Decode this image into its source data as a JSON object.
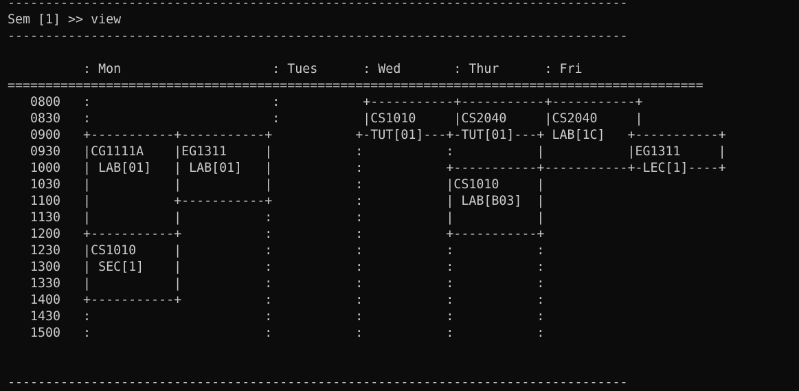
{
  "terminal": {
    "colors": {
      "background": "#0c0c0c",
      "foreground": "#cccccc"
    },
    "lines": [
      "----------------------------------------------------------------------------------",
      "Sem [1] >> view",
      "----------------------------------------------------------------------------------",
      "",
      "          : Mon                    : Tues      : Wed       : Thur      : Fri",
      "============================================================================================",
      "   0800   :                        :           +-----------+-----------+-----------+",
      "   0830   :                        :           |CS1010     |CS2040     |CS2040     |",
      "   0900   +-----------+-----------+           +-TUT[01]---+-TUT[01]---+ LAB[1C]   +-----------+",
      "   0930   |CG1111A    |EG1311     |           :           :           |           |EG1311     |",
      "   1000   | LAB[01]   | LAB[01]   |           :           +-----------+-----------+-LEC[1]----+",
      "   1030   |           |           |           :           |CS1010     |",
      "   1100   |           +-----------+           :           | LAB[B03]  |",
      "   1130   |           |           :           :           |           |",
      "   1200   +-----------+           :           :           +-----------+",
      "   1230   |CS1010     |           :           :           :           :",
      "   1300   | SEC[1]    |           :           :           :           :",
      "   1330   |           |           :           :           :           :",
      "   1400   +-----------+           :           :           :           :",
      "   1430   :                       :           :           :           :",
      "   1500   :                       :           :           :           :",
      "",
      "",
      "----------------------------------------------------------------------------------"
    ]
  }
}
